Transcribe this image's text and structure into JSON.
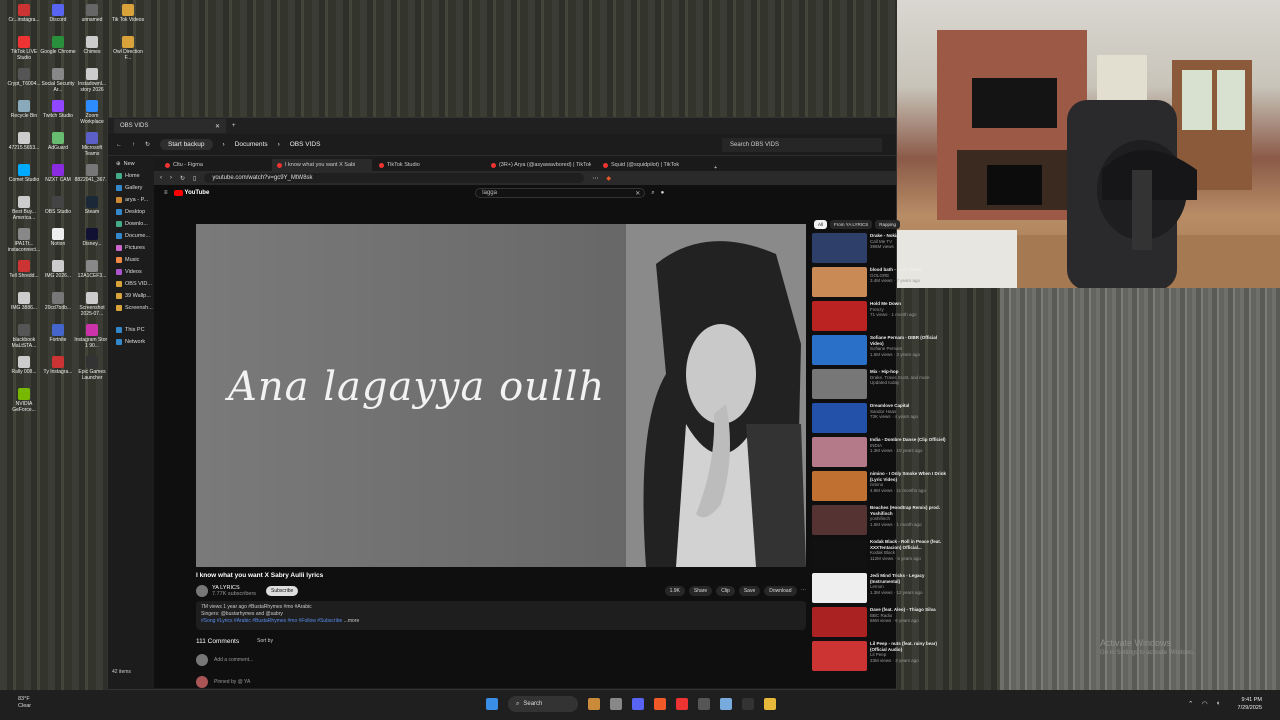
{
  "desktop": {
    "icons": [
      {
        "label": "Cr...instagra...",
        "c": "#c33"
      },
      {
        "label": "Discord",
        "c": "#5865f2"
      },
      {
        "label": "unnamed",
        "c": "#666"
      },
      {
        "label": "Tik Tok Videos",
        "c": "#d8a33a"
      },
      {
        "label": "TikTok LIVE Studio",
        "c": "#e33"
      },
      {
        "label": "Google Chrome",
        "c": "#2a8f3a"
      },
      {
        "label": "Chimes",
        "c": "#ccc"
      },
      {
        "label": "Owl Direction F...",
        "c": "#d8a33a"
      },
      {
        "label": "Crypt_T6004...",
        "c": "#555"
      },
      {
        "label": "Social Security Ar...",
        "c": "#888"
      },
      {
        "label": "Instadownl... story 2026",
        "c": "#ccc"
      },
      {
        "label": "Recycle Bin",
        "c": "#8ab"
      },
      {
        "label": "Twitch Studio",
        "c": "#9146ff"
      },
      {
        "label": "Zoom Workplace",
        "c": "#2d8cff"
      },
      {
        "label": "47215.5653...",
        "c": "#ccc"
      },
      {
        "label": "AdGuard",
        "c": "#68bc71"
      },
      {
        "label": "Microsoft Teams",
        "c": "#5b5fc7"
      },
      {
        "label": "Comet Studio",
        "c": "#0af"
      },
      {
        "label": "NZXT CAM",
        "c": "#8a2be2"
      },
      {
        "label": "8822041_367...",
        "c": "#777"
      },
      {
        "label": "Best Buy... America...",
        "c": "#ccc"
      },
      {
        "label": "OBS Studio",
        "c": "#444"
      },
      {
        "label": "Steam",
        "c": "#1b2838"
      },
      {
        "label": "IPA1Tt... instaconnect...",
        "c": "#888"
      },
      {
        "label": "Notion",
        "c": "#eee"
      },
      {
        "label": "Disney...",
        "c": "#113"
      },
      {
        "label": "Tell Shredd...",
        "c": "#c33"
      },
      {
        "label": "IMG 2026...",
        "c": "#ccc"
      },
      {
        "label": "12A1CEF3...",
        "c": "#888"
      },
      {
        "label": "IMG 3886...",
        "c": "#ccc"
      },
      {
        "label": "20cd7bdb...",
        "c": "#777"
      },
      {
        "label": "Screenshot 2025-07...",
        "c": "#ccc"
      },
      {
        "label": "blackbook MaLtSTA...",
        "c": "#555"
      },
      {
        "label": "Fortnite",
        "c": "#46c"
      },
      {
        "label": "Instagram Story 1 90...",
        "c": "#c3a"
      },
      {
        "label": "Rally 008...",
        "c": "#ccc"
      },
      {
        "label": "Ty Instagra...",
        "c": "#c33"
      },
      {
        "label": "Epic Games Launcher",
        "c": "#333"
      },
      {
        "label": "NVIDIA GeForce...",
        "c": "#76b900"
      }
    ]
  },
  "obs": {
    "tab_title": "OBS VIDS",
    "backup": "Start backup",
    "crumb1": "Documents",
    "crumb2": "OBS VIDS",
    "search_placeholder": "Search OBS VIDS",
    "new": "New",
    "status": "42 items",
    "sidebar": [
      "Home",
      "Gallery",
      "arya - P...",
      "Desktop",
      "Downlo...",
      "Docume...",
      "Pictures",
      "Music",
      "Videos",
      "OBS VID...",
      "39 Wallp...",
      "Screensh...",
      "This PC",
      "Network"
    ]
  },
  "browser": {
    "tabs": [
      "Cltu - Figma",
      "I know what you want X Sabi",
      "TikTok Studio",
      "(3R+) Arya (@asyawavbored) | TikTok",
      "Squid (@squidpilot) | TikTok"
    ],
    "url": "youtube.com/watch?v=gc9Y_MtW8sk"
  },
  "youtube": {
    "logo": "YouTube",
    "search": "lagga",
    "lyric": "Ana lagayya oullh",
    "video_title": "I know what you want X Sabry Aulli lyrics",
    "channel": "YA LYRICS",
    "subs": "7.77K subscribers",
    "subscribe": "Subscribe",
    "actions": [
      "1.9K",
      "Share",
      "Clip",
      "Save",
      "Download"
    ],
    "desc_line1": "7M views 1 year ago #BustaRhymes #mo #Arabic",
    "desc_line2": "Singers: @bustarhymes and @sabry",
    "desc_tags": "#Song #Lyrics #Arabic #BustaRhymes #mo #Follow #Subscribe",
    "desc_more": "...more",
    "comments": "111 Comments",
    "sort": "Sort by",
    "add_comment": "Add a comment...",
    "first_comment": "Pinned by @ YA"
  },
  "recs": {
    "chips": [
      "All",
      "From YA LYRICS",
      "Rapping"
    ],
    "items": [
      {
        "t": "Drake - Nokia",
        "c": "Call Me TV",
        "m": "396M views",
        "col": "#2e3f6a"
      },
      {
        "t": "blood bath - Lord SHINR",
        "c": "GOLGRE",
        "m": "3.4M views · 7 years ago",
        "col": "#c98a56"
      },
      {
        "t": "Hold Me Down",
        "c": "Frenzy",
        "m": "71 views · 1 month ago",
        "col": "#b22"
      },
      {
        "t": "Sofiane Pernam - DIBR (Official Video)",
        "c": "Sofiane Pernam",
        "m": "1.5M views · 3 years ago",
        "col": "#2a70c8"
      },
      {
        "t": "Mix - Hip-hop",
        "c": "Drake, Travis Scott, and more",
        "m": "Updated today",
        "col": "#777"
      },
      {
        "t": "Dreamlove Capital",
        "c": "Sandor Haas",
        "m": "73K views · 4 years ago",
        "col": "#2350a8"
      },
      {
        "t": "India - Dombre Danse (Clip Officiel)",
        "c": "INDIA",
        "m": "1.3M views · 10 years ago",
        "col": "#b57a8a"
      },
      {
        "t": "nimino - I Only Smoke When I Drink (Lyric Video)",
        "c": "nimino",
        "m": "4.9M views · 11 months ago",
        "col": "#c07030"
      },
      {
        "t": "Beaches (Hoodtrap Remix) prod. Yoshifinch",
        "c": "yoshifinch",
        "m": "1.5M views · 1 month ago",
        "col": "#533"
      },
      {
        "t": "Kodak Black - Roll in Peace (feat. XXXTentacion) Official...",
        "c": "Kodak Black",
        "m": "112M views · 6 years ago",
        "col": "#111"
      },
      {
        "t": "Jedi Mind Tricks - Legacy (Instrumental)",
        "c": "Lemon",
        "m": "1.3M views · 12 years ago",
        "col": "#eee"
      },
      {
        "t": "Dave (feat. Aleo) - Thiago Silva",
        "c": "BBC Radio",
        "m": "66M views · 6 years ago",
        "col": "#a22"
      },
      {
        "t": "Lil Peep - nuts (feat. rainy bear) (Official Audio)",
        "c": "Lil Peep",
        "m": "23M views · 3 years ago",
        "col": "#c33"
      }
    ]
  },
  "taskbar": {
    "temp": "83°F",
    "cond": "Clear",
    "search": "Search",
    "time": "9:41 PM",
    "date": "7/29/2025"
  },
  "activate": {
    "line1": "Activate Windows",
    "line2": "Go to Settings to activate Windows."
  }
}
